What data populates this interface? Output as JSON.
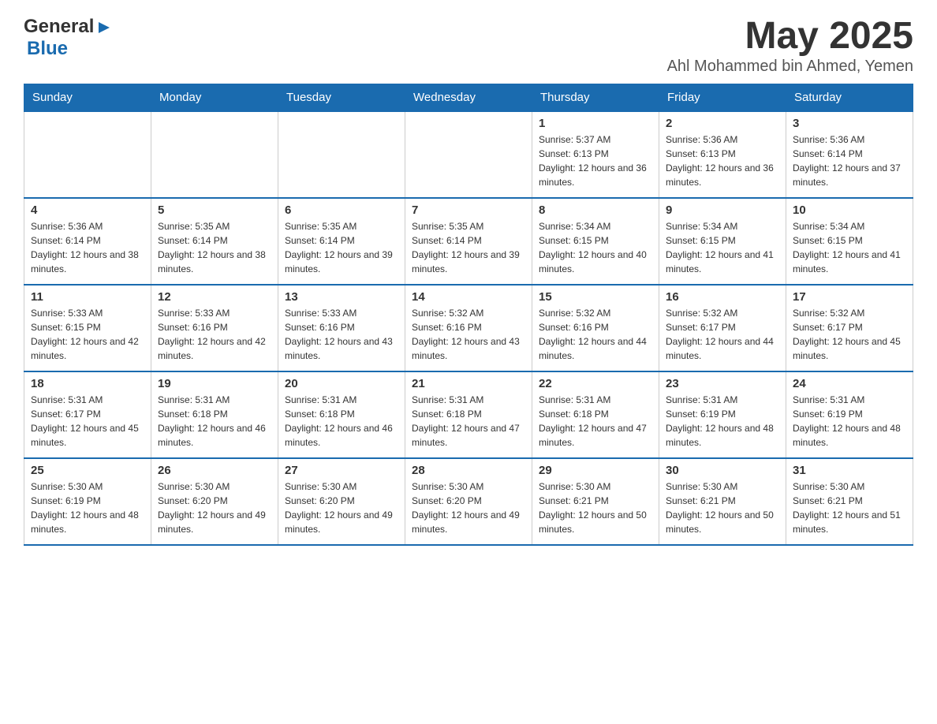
{
  "header": {
    "logo": {
      "text_general": "General",
      "triangle": "▶",
      "text_blue": "Blue"
    },
    "month_title": "May 2025",
    "subtitle": "Ahl Mohammed bin Ahmed, Yemen"
  },
  "weekdays": [
    "Sunday",
    "Monday",
    "Tuesday",
    "Wednesday",
    "Thursday",
    "Friday",
    "Saturday"
  ],
  "weeks": [
    [
      {
        "day": "",
        "info": ""
      },
      {
        "day": "",
        "info": ""
      },
      {
        "day": "",
        "info": ""
      },
      {
        "day": "",
        "info": ""
      },
      {
        "day": "1",
        "info": "Sunrise: 5:37 AM\nSunset: 6:13 PM\nDaylight: 12 hours and 36 minutes."
      },
      {
        "day": "2",
        "info": "Sunrise: 5:36 AM\nSunset: 6:13 PM\nDaylight: 12 hours and 36 minutes."
      },
      {
        "day": "3",
        "info": "Sunrise: 5:36 AM\nSunset: 6:14 PM\nDaylight: 12 hours and 37 minutes."
      }
    ],
    [
      {
        "day": "4",
        "info": "Sunrise: 5:36 AM\nSunset: 6:14 PM\nDaylight: 12 hours and 38 minutes."
      },
      {
        "day": "5",
        "info": "Sunrise: 5:35 AM\nSunset: 6:14 PM\nDaylight: 12 hours and 38 minutes."
      },
      {
        "day": "6",
        "info": "Sunrise: 5:35 AM\nSunset: 6:14 PM\nDaylight: 12 hours and 39 minutes."
      },
      {
        "day": "7",
        "info": "Sunrise: 5:35 AM\nSunset: 6:14 PM\nDaylight: 12 hours and 39 minutes."
      },
      {
        "day": "8",
        "info": "Sunrise: 5:34 AM\nSunset: 6:15 PM\nDaylight: 12 hours and 40 minutes."
      },
      {
        "day": "9",
        "info": "Sunrise: 5:34 AM\nSunset: 6:15 PM\nDaylight: 12 hours and 41 minutes."
      },
      {
        "day": "10",
        "info": "Sunrise: 5:34 AM\nSunset: 6:15 PM\nDaylight: 12 hours and 41 minutes."
      }
    ],
    [
      {
        "day": "11",
        "info": "Sunrise: 5:33 AM\nSunset: 6:15 PM\nDaylight: 12 hours and 42 minutes."
      },
      {
        "day": "12",
        "info": "Sunrise: 5:33 AM\nSunset: 6:16 PM\nDaylight: 12 hours and 42 minutes."
      },
      {
        "day": "13",
        "info": "Sunrise: 5:33 AM\nSunset: 6:16 PM\nDaylight: 12 hours and 43 minutes."
      },
      {
        "day": "14",
        "info": "Sunrise: 5:32 AM\nSunset: 6:16 PM\nDaylight: 12 hours and 43 minutes."
      },
      {
        "day": "15",
        "info": "Sunrise: 5:32 AM\nSunset: 6:16 PM\nDaylight: 12 hours and 44 minutes."
      },
      {
        "day": "16",
        "info": "Sunrise: 5:32 AM\nSunset: 6:17 PM\nDaylight: 12 hours and 44 minutes."
      },
      {
        "day": "17",
        "info": "Sunrise: 5:32 AM\nSunset: 6:17 PM\nDaylight: 12 hours and 45 minutes."
      }
    ],
    [
      {
        "day": "18",
        "info": "Sunrise: 5:31 AM\nSunset: 6:17 PM\nDaylight: 12 hours and 45 minutes."
      },
      {
        "day": "19",
        "info": "Sunrise: 5:31 AM\nSunset: 6:18 PM\nDaylight: 12 hours and 46 minutes."
      },
      {
        "day": "20",
        "info": "Sunrise: 5:31 AM\nSunset: 6:18 PM\nDaylight: 12 hours and 46 minutes."
      },
      {
        "day": "21",
        "info": "Sunrise: 5:31 AM\nSunset: 6:18 PM\nDaylight: 12 hours and 47 minutes."
      },
      {
        "day": "22",
        "info": "Sunrise: 5:31 AM\nSunset: 6:18 PM\nDaylight: 12 hours and 47 minutes."
      },
      {
        "day": "23",
        "info": "Sunrise: 5:31 AM\nSunset: 6:19 PM\nDaylight: 12 hours and 48 minutes."
      },
      {
        "day": "24",
        "info": "Sunrise: 5:31 AM\nSunset: 6:19 PM\nDaylight: 12 hours and 48 minutes."
      }
    ],
    [
      {
        "day": "25",
        "info": "Sunrise: 5:30 AM\nSunset: 6:19 PM\nDaylight: 12 hours and 48 minutes."
      },
      {
        "day": "26",
        "info": "Sunrise: 5:30 AM\nSunset: 6:20 PM\nDaylight: 12 hours and 49 minutes."
      },
      {
        "day": "27",
        "info": "Sunrise: 5:30 AM\nSunset: 6:20 PM\nDaylight: 12 hours and 49 minutes."
      },
      {
        "day": "28",
        "info": "Sunrise: 5:30 AM\nSunset: 6:20 PM\nDaylight: 12 hours and 49 minutes."
      },
      {
        "day": "29",
        "info": "Sunrise: 5:30 AM\nSunset: 6:21 PM\nDaylight: 12 hours and 50 minutes."
      },
      {
        "day": "30",
        "info": "Sunrise: 5:30 AM\nSunset: 6:21 PM\nDaylight: 12 hours and 50 minutes."
      },
      {
        "day": "31",
        "info": "Sunrise: 5:30 AM\nSunset: 6:21 PM\nDaylight: 12 hours and 51 minutes."
      }
    ]
  ]
}
